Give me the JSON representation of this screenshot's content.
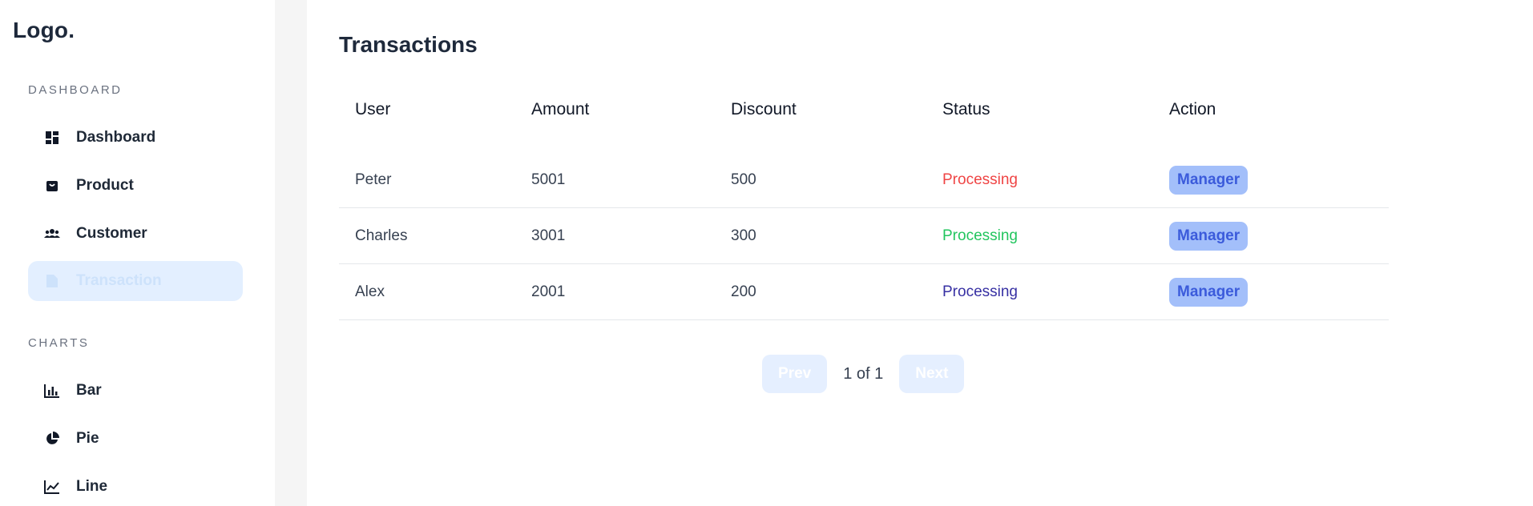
{
  "sidebar": {
    "logo": "Logo.",
    "sections": [
      {
        "title": "DASHBOARD",
        "items": [
          {
            "label": "Dashboard",
            "icon": "grid-dashboard-icon"
          },
          {
            "label": "Product",
            "icon": "shopping-bag-icon"
          },
          {
            "label": "Customer",
            "icon": "users-group-icon"
          },
          {
            "label": "Transaction",
            "icon": "document-icon",
            "active": true
          }
        ]
      },
      {
        "title": "CHARTS",
        "items": [
          {
            "label": "Bar",
            "icon": "bar-chart-icon"
          },
          {
            "label": "Pie",
            "icon": "pie-chart-icon"
          },
          {
            "label": "Line",
            "icon": "line-chart-icon"
          }
        ]
      }
    ]
  },
  "main": {
    "title": "Transactions",
    "table": {
      "headers": [
        "User",
        "Amount",
        "Discount",
        "Status",
        "Action"
      ],
      "rows": [
        {
          "user": "Peter",
          "amount": "5001",
          "discount": "500",
          "status": "Processing",
          "status_color": "#ef4444",
          "action": "Manager"
        },
        {
          "user": "Charles",
          "amount": "3001",
          "discount": "300",
          "status": "Processing",
          "status_color": "#22c55e",
          "action": "Manager"
        },
        {
          "user": "Alex",
          "amount": "2001",
          "discount": "200",
          "status": "Processing",
          "status_color": "#3730a3",
          "action": "Manager"
        }
      ]
    },
    "pagination": {
      "prev_label": "Prev",
      "page_text": "1 of 1",
      "next_label": "Next"
    }
  },
  "colors": {
    "accent_light": "#e3efff",
    "manager_bg": "#a3bffa",
    "manager_text": "#3b5bdb"
  }
}
